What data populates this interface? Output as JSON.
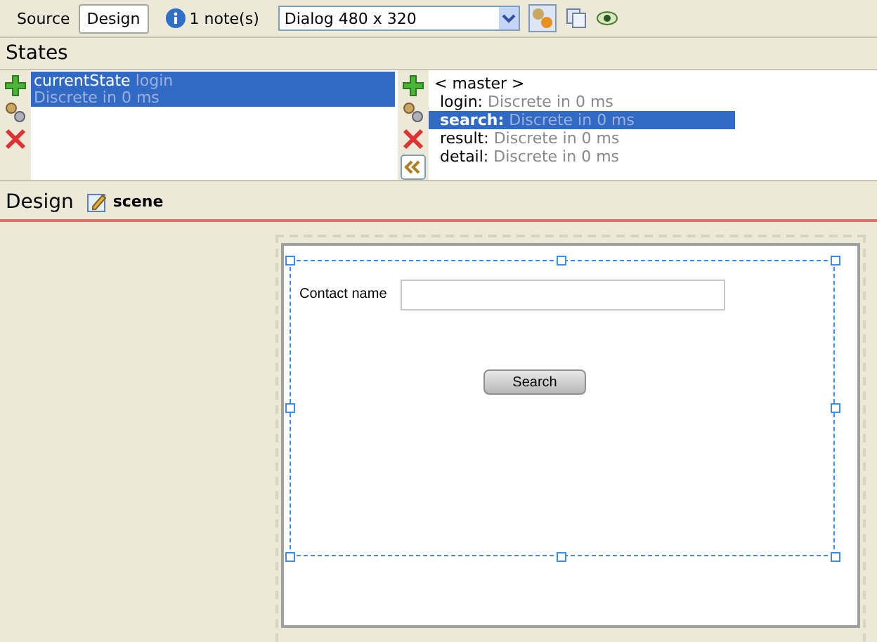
{
  "toolbar": {
    "tabs": [
      {
        "label": "Source",
        "selected": false
      },
      {
        "label": "Design",
        "selected": true
      }
    ],
    "notes": "1 note(s)",
    "device": "Dialog 480 x 320"
  },
  "states": {
    "title": "States",
    "current_state": {
      "name": "currentState",
      "value": "login",
      "transition": "Discrete in 0 ms",
      "selected": true
    },
    "list": [
      {
        "name": "< master >",
        "selected": false
      },
      {
        "name": "login:",
        "transition": "Discrete in 0 ms",
        "selected": false
      },
      {
        "name": "search:",
        "transition": "Discrete in 0 ms",
        "selected": true
      },
      {
        "name": "result:",
        "transition": "Discrete in 0 ms",
        "selected": false
      },
      {
        "name": "detail:",
        "transition": "Discrete in 0 ms",
        "selected": false
      }
    ]
  },
  "design": {
    "title": "Design",
    "scene": "scene",
    "form": {
      "label": "Contact name",
      "button": "Search"
    }
  }
}
